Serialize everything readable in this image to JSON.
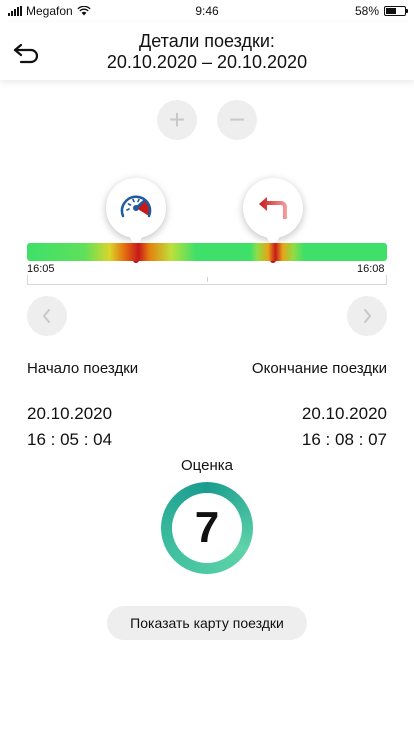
{
  "status_bar": {
    "carrier": "Megafon",
    "time": "9:46",
    "battery_text": "58%",
    "battery_level": 0.58
  },
  "header": {
    "title": "Детали поездки:\n20.10.2020 – 20.10.2020"
  },
  "zoom": {
    "in_label": "+",
    "out_label": "−"
  },
  "timeline": {
    "start_time": "16:05",
    "end_time": "16:08"
  },
  "events": [
    {
      "icon": "speedometer-icon",
      "color": "#c8181a"
    },
    {
      "icon": "turn-left-arrow-icon",
      "color": "#c8181a"
    }
  ],
  "trip": {
    "start_label": "Начало поездки",
    "end_label": "Окончание поездки",
    "start_date": "20.10.2020",
    "start_time": "16 : 05 : 04",
    "end_date": "20.10.2020",
    "end_time": "16 : 08 : 07"
  },
  "score": {
    "label": "Оценка",
    "value": "7"
  },
  "map_button": {
    "label": "Показать карту поездки"
  },
  "colors": {
    "good": "#3ee06a",
    "bad": "#c8181a",
    "ring": "#3fbf9f"
  }
}
